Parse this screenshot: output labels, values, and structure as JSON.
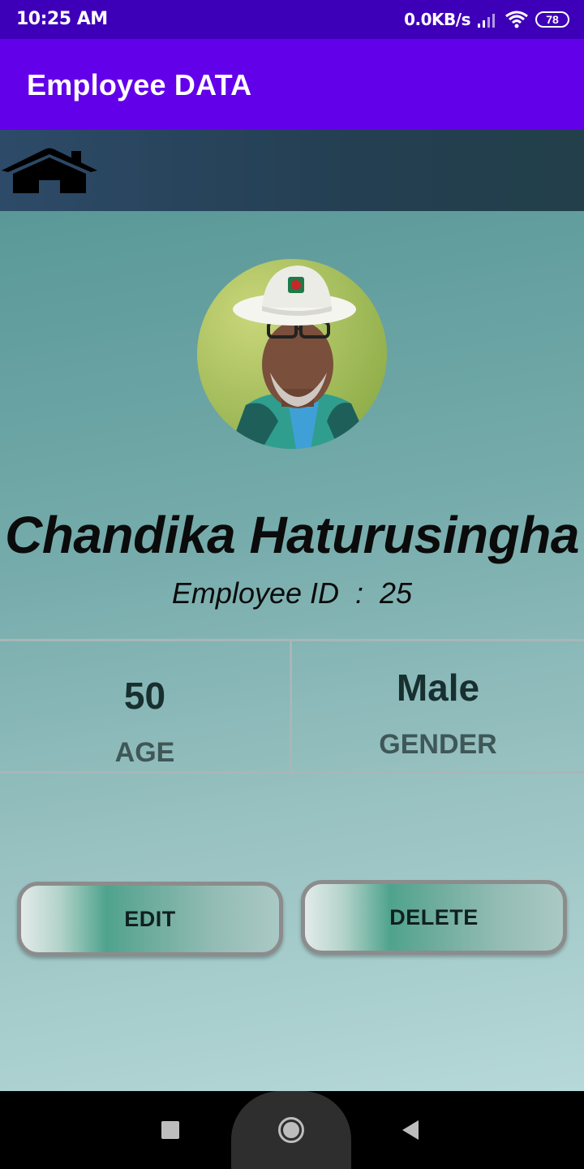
{
  "status_bar": {
    "time": "10:25 AM",
    "speed": "0.0KB/s",
    "battery": "78",
    "icons": [
      "signal-icon",
      "wifi-icon",
      "battery-icon"
    ]
  },
  "app_bar": {
    "title": "Employee DATA"
  },
  "home_strip": {
    "icon": "home-icon"
  },
  "employee": {
    "name": "Chandika Haturusingha",
    "id_line": "Employee ID  :  25",
    "photo": "employee-photo"
  },
  "stats": {
    "age_value": "50",
    "age_label": "AGE",
    "gender_value": "Male",
    "gender_label": "GENDER"
  },
  "actions": {
    "edit_label": "EDIT",
    "delete_label": "DELETE"
  },
  "nav_bar": {
    "icons": [
      "recent-apps-icon",
      "home-circle-icon",
      "back-icon"
    ]
  },
  "colors": {
    "status_bar": "#3d00b8",
    "app_bar": "#6200ea",
    "home_strip": "#243f52",
    "content_top": "#5a9898",
    "content_bottom": "#b6d8d8"
  }
}
